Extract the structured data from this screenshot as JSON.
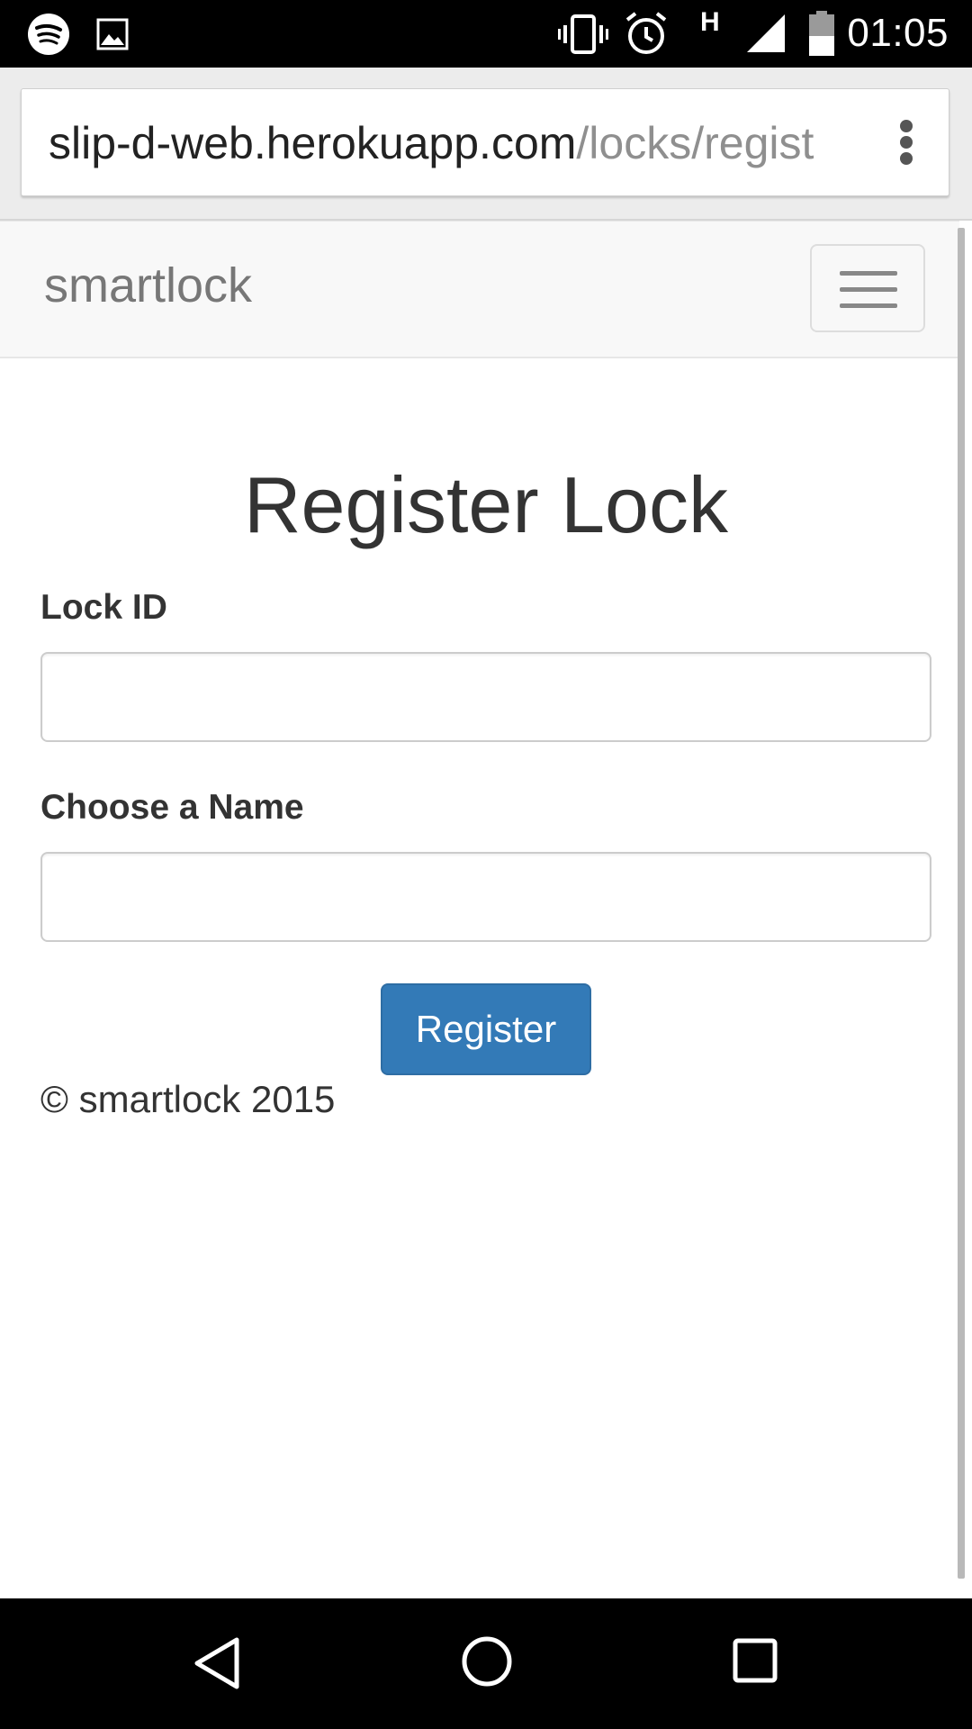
{
  "status_bar": {
    "time": "01:05",
    "network": "H",
    "left_icons": [
      "spotify-icon",
      "image-icon"
    ],
    "right_icons": [
      "vibrate-icon",
      "alarm-icon",
      "network-h-icon",
      "signal-icon",
      "battery-icon"
    ]
  },
  "browser": {
    "url_host": "slip-d-web.herokuapp.com",
    "url_path": "/locks/regist",
    "menu_icon": "more-vert-icon"
  },
  "navbar": {
    "brand": "smartlock",
    "toggle_icon": "hamburger-icon"
  },
  "form": {
    "title": "Register Lock",
    "lock_id_label": "Lock ID",
    "lock_id_value": "",
    "name_label": "Choose a Name",
    "name_value": "",
    "submit_label": "Register"
  },
  "footer": {
    "text": "© smartlock 2015"
  },
  "android_nav": {
    "icons": [
      "back-icon",
      "home-icon",
      "recents-icon"
    ]
  },
  "colors": {
    "primary_button": "#337ab7",
    "navbar_bg": "#f8f8f8",
    "brand_text": "#777777"
  }
}
